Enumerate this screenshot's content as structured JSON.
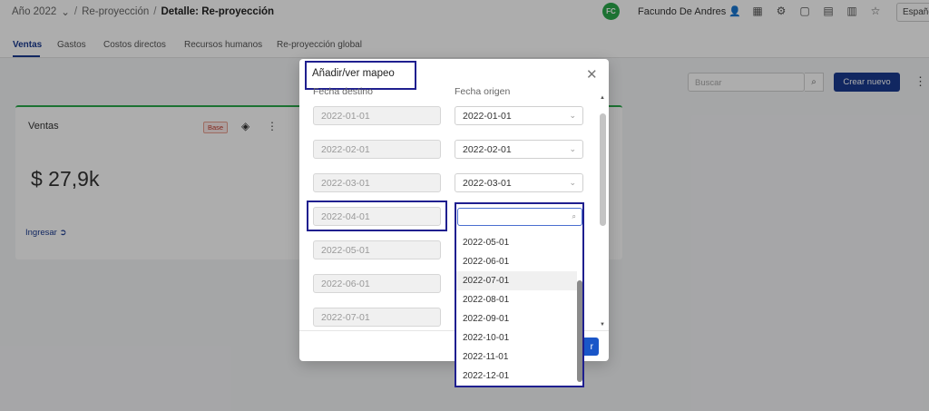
{
  "breadcrumb": {
    "year": "Año 2022",
    "reproyeccion": "Re-proyección",
    "detail": "Detalle: Re-proyección"
  },
  "user": {
    "initials": "FC",
    "name": "Facundo De Andres"
  },
  "language": "Españo",
  "tabs": [
    "Ventas",
    "Gastos",
    "Costos directos",
    "Recursos humanos",
    "Re-proyección global"
  ],
  "toolbar": {
    "search_placeholder": "Buscar",
    "create_label": "Crear nuevo"
  },
  "card": {
    "title": "Ventas",
    "badge": "Base",
    "value": "$ 27,9k",
    "link": "Ingresar"
  },
  "modal": {
    "title": "Añadir/ver mapeo",
    "col_destino": "Fecha destino",
    "col_origen": "Fecha origen",
    "rows": [
      {
        "destino": "2022-01-01",
        "origen": "2022-01-01"
      },
      {
        "destino": "2022-02-01",
        "origen": "2022-02-01"
      },
      {
        "destino": "2022-03-01",
        "origen": "2022-03-01"
      },
      {
        "destino": "2022-04-01",
        "origen": ""
      },
      {
        "destino": "2022-05-01",
        "origen": ""
      },
      {
        "destino": "2022-06-01",
        "origen": ""
      },
      {
        "destino": "2022-07-01",
        "origen": ""
      }
    ],
    "save_label": "r"
  },
  "dropdown": {
    "options": [
      "2022-05-01",
      "2022-06-01",
      "2022-07-01",
      "2022-08-01",
      "2022-09-01",
      "2022-10-01",
      "2022-11-01",
      "2022-12-01"
    ],
    "active_option": "2022-07-01"
  },
  "colors": {
    "primary": "#1a3a8f",
    "success": "#2aa84a",
    "highlight": "#1f1f8f"
  }
}
